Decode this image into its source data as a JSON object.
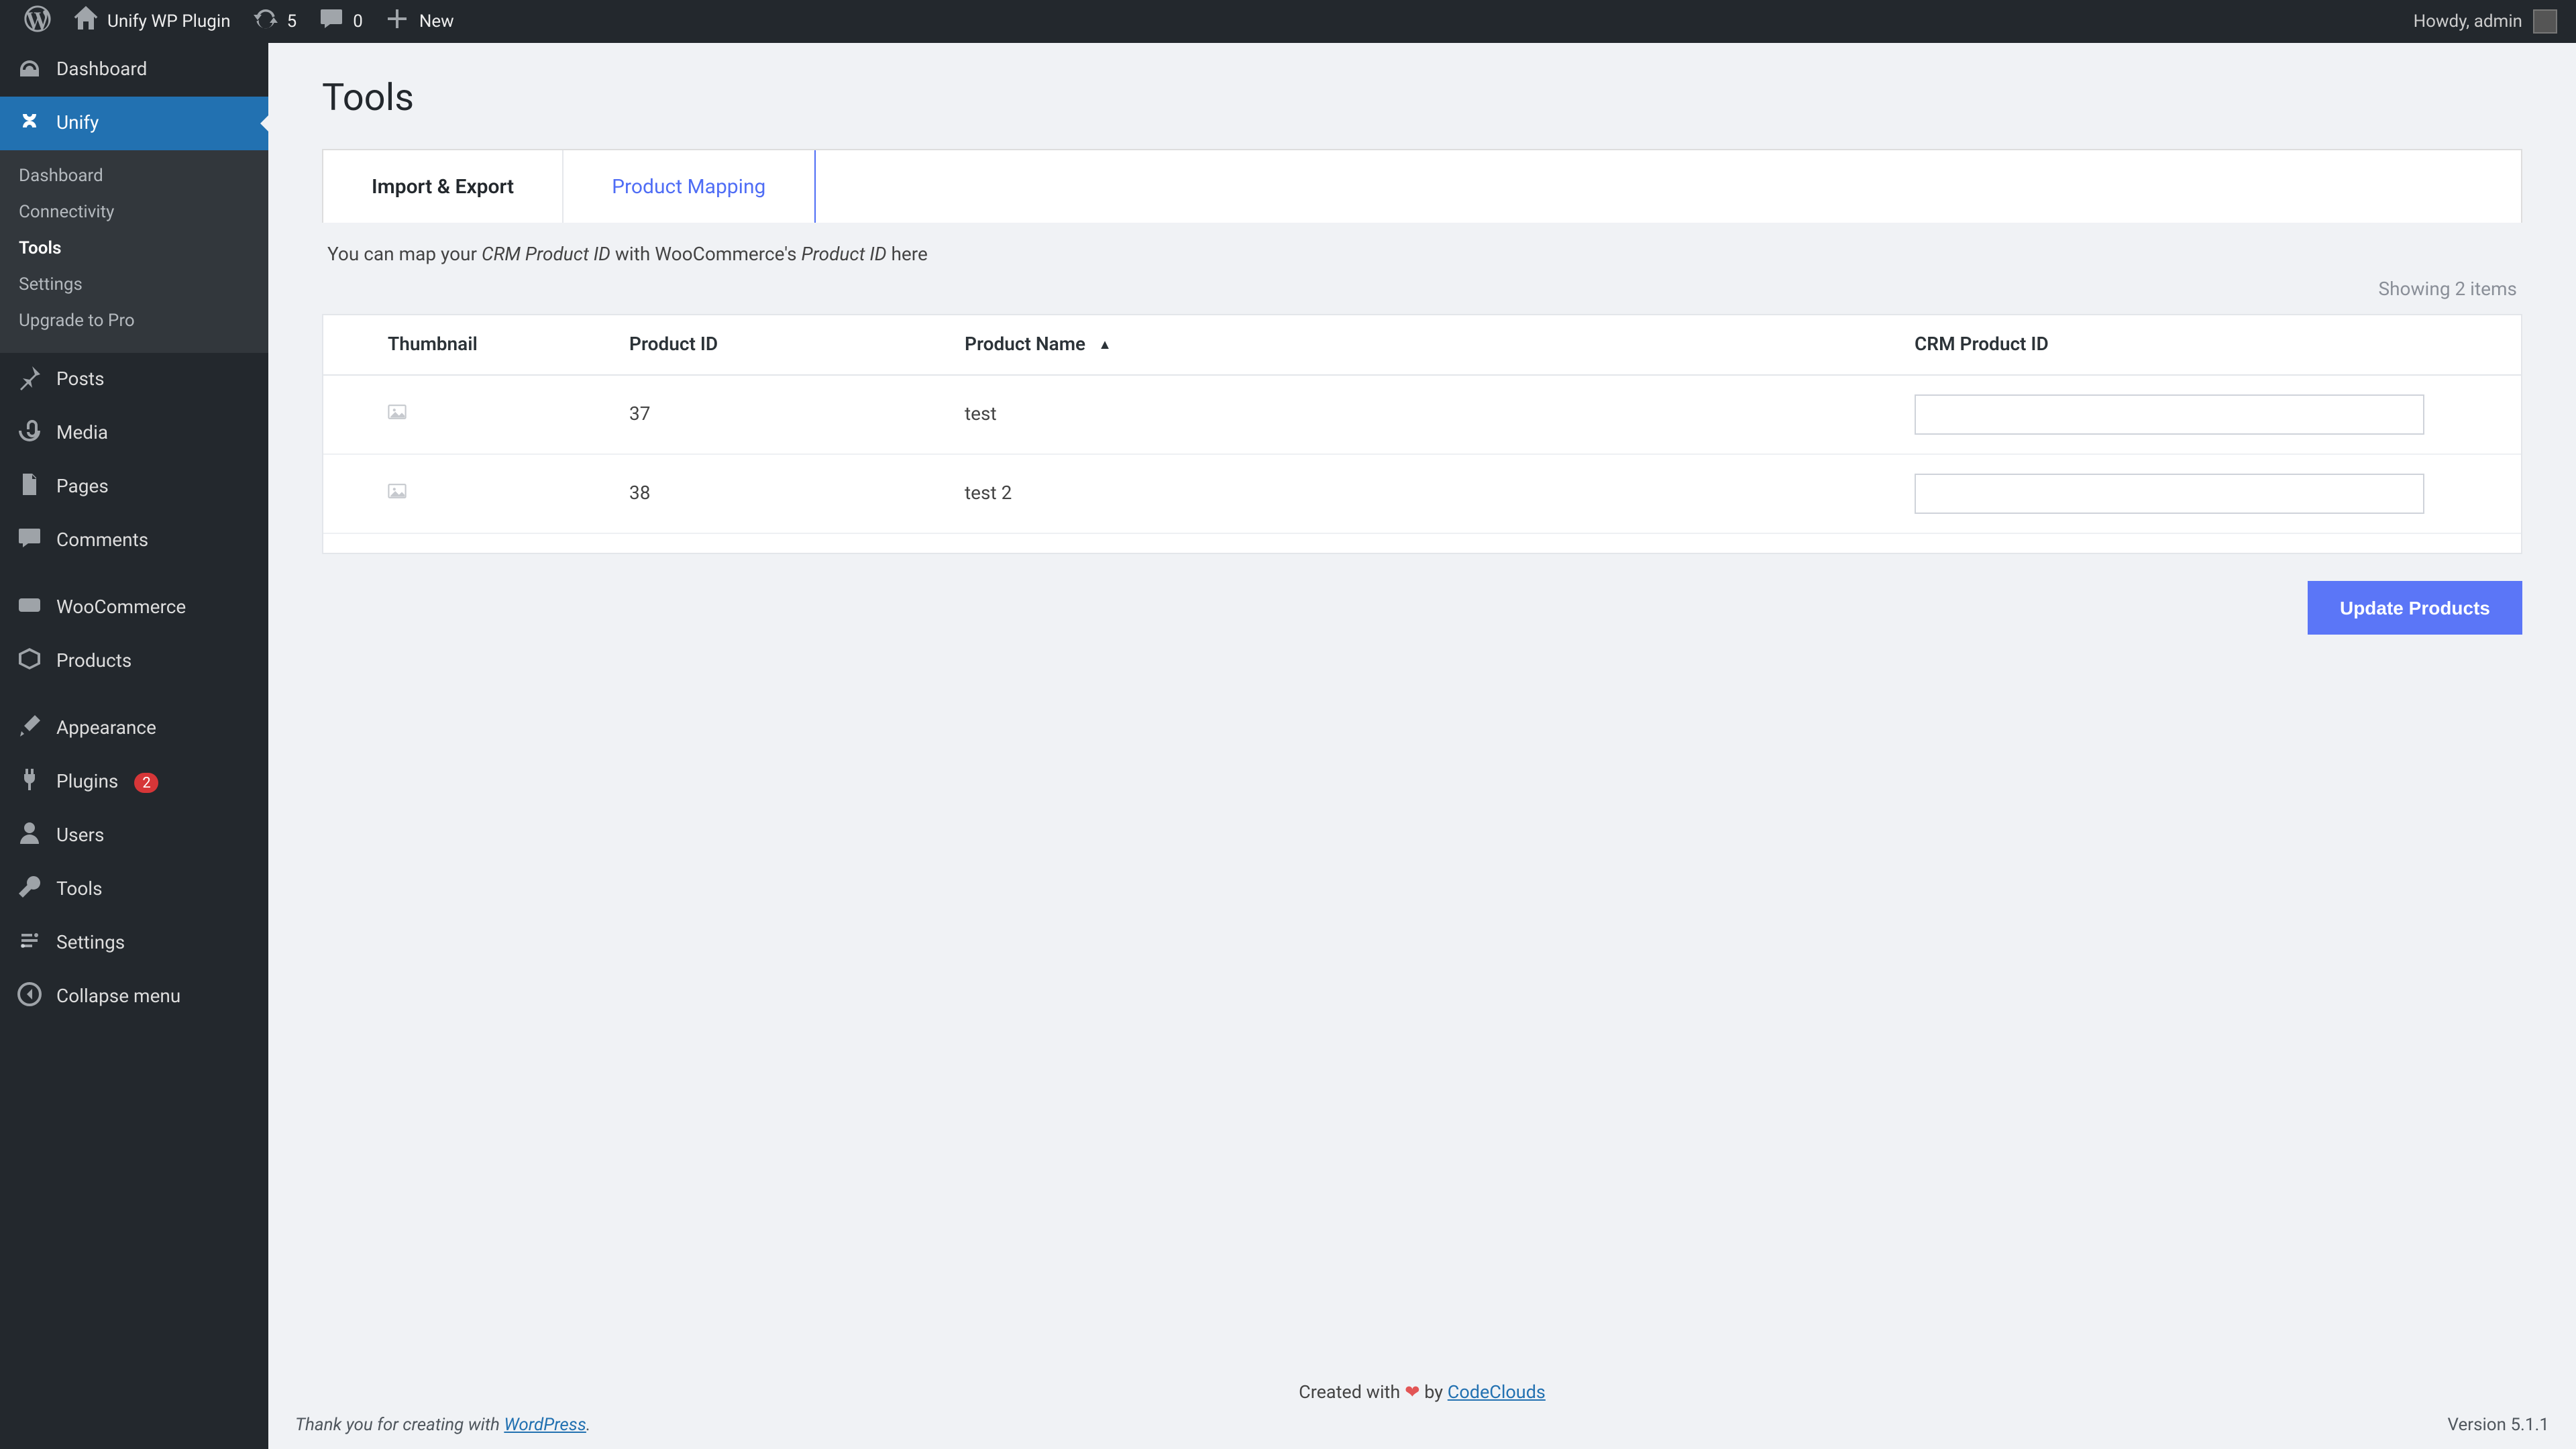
{
  "topbar": {
    "site_name": "Unify WP Plugin",
    "updates_count": "5",
    "comments_count": "0",
    "new_label": "New",
    "greeting": "Howdy, admin"
  },
  "sidebar": {
    "items": [
      {
        "label": "Dashboard"
      },
      {
        "label": "Unify",
        "current": true
      },
      {
        "label": "Posts"
      },
      {
        "label": "Media"
      },
      {
        "label": "Pages"
      },
      {
        "label": "Comments"
      },
      {
        "label": "WooCommerce"
      },
      {
        "label": "Products"
      },
      {
        "label": "Appearance"
      },
      {
        "label": "Plugins",
        "badge": "2"
      },
      {
        "label": "Users"
      },
      {
        "label": "Tools"
      },
      {
        "label": "Settings"
      },
      {
        "label": "Collapse menu"
      }
    ],
    "submenu": [
      {
        "label": "Dashboard"
      },
      {
        "label": "Connectivity"
      },
      {
        "label": "Tools",
        "current": true
      },
      {
        "label": "Settings"
      },
      {
        "label": "Upgrade to Pro"
      }
    ]
  },
  "page": {
    "title": "Tools",
    "tabs": [
      {
        "label": "Import & Export",
        "active": false
      },
      {
        "label": "Product Mapping",
        "active": true
      }
    ],
    "desc_pre": "You can map your ",
    "desc_em1": "CRM Product ID",
    "desc_mid": " with WooCommerce's ",
    "desc_em2": "Product ID",
    "desc_post": " here",
    "showing_text": "Showing 2 items",
    "columns": {
      "thumb": "Thumbnail",
      "pid": "Product ID",
      "pname": "Product Name",
      "crm": "CRM Product ID"
    },
    "sort_arrow": "▲",
    "rows": [
      {
        "pid": "37",
        "pname": "test",
        "crm": ""
      },
      {
        "pid": "38",
        "pname": "test 2",
        "crm": ""
      }
    ],
    "update_btn": "Update Products"
  },
  "credit": {
    "pre": "Created with ",
    "heart": "❤",
    "mid": " by ",
    "link": "CodeClouds"
  },
  "footer": {
    "thanks_pre": "Thank you for creating with ",
    "wp": "WordPress",
    "thanks_post": ".",
    "version": "Version 5.1.1"
  }
}
